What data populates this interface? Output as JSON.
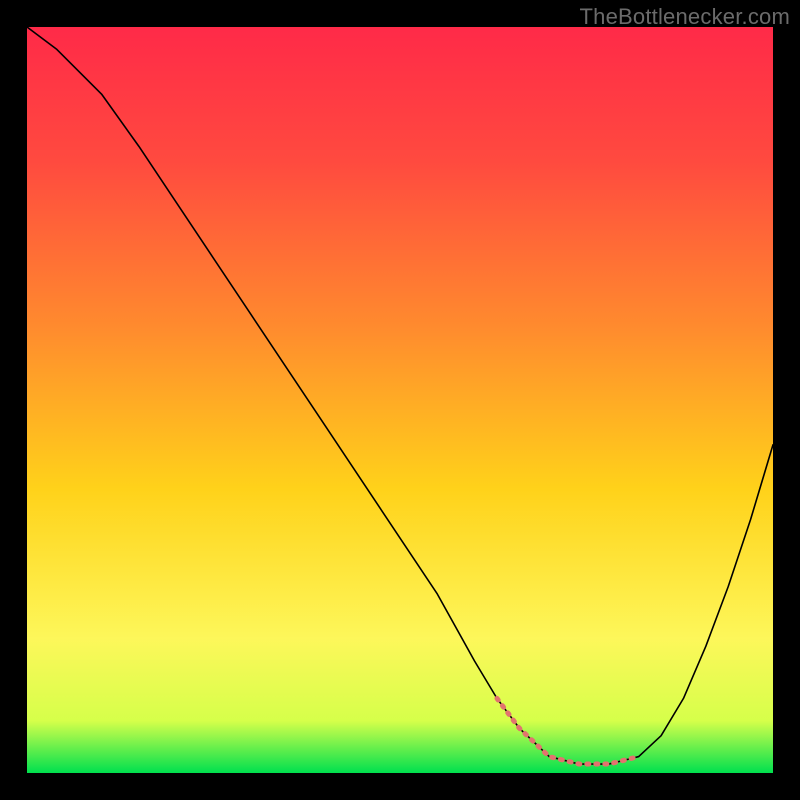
{
  "watermark": "TheBottlenecker.com",
  "chart_data": {
    "type": "line",
    "title": "",
    "xlabel": "",
    "ylabel": "",
    "xlim": [
      0,
      100
    ],
    "ylim": [
      0,
      100
    ],
    "gradient_stops": [
      {
        "offset": 0,
        "color": "#ff2a48"
      },
      {
        "offset": 18,
        "color": "#ff4a3f"
      },
      {
        "offset": 40,
        "color": "#ff8a2e"
      },
      {
        "offset": 62,
        "color": "#ffd21a"
      },
      {
        "offset": 82,
        "color": "#fdf75a"
      },
      {
        "offset": 93,
        "color": "#d6ff4a"
      },
      {
        "offset": 100,
        "color": "#00e04e"
      }
    ],
    "series": [
      {
        "name": "bottleneck-curve",
        "color": "#000000",
        "width": 1.6,
        "x": [
          0,
          4,
          7,
          10,
          15,
          20,
          25,
          30,
          35,
          40,
          45,
          50,
          55,
          60,
          63,
          66,
          70,
          74,
          78,
          82,
          85,
          88,
          91,
          94,
          97,
          100
        ],
        "y": [
          100,
          97,
          94,
          91,
          84,
          76.5,
          69,
          61.5,
          54,
          46.5,
          39,
          31.5,
          24,
          15,
          10,
          6,
          2.2,
          1.2,
          1.2,
          2.2,
          5,
          10,
          17,
          25,
          34,
          44
        ]
      },
      {
        "name": "trough-highlight",
        "color": "#e2736e",
        "width": 5,
        "dash": "2 7",
        "x": [
          63,
          66,
          70,
          74,
          78,
          82
        ],
        "y": [
          10,
          6,
          2.2,
          1.2,
          1.2,
          2.2
        ]
      }
    ]
  }
}
